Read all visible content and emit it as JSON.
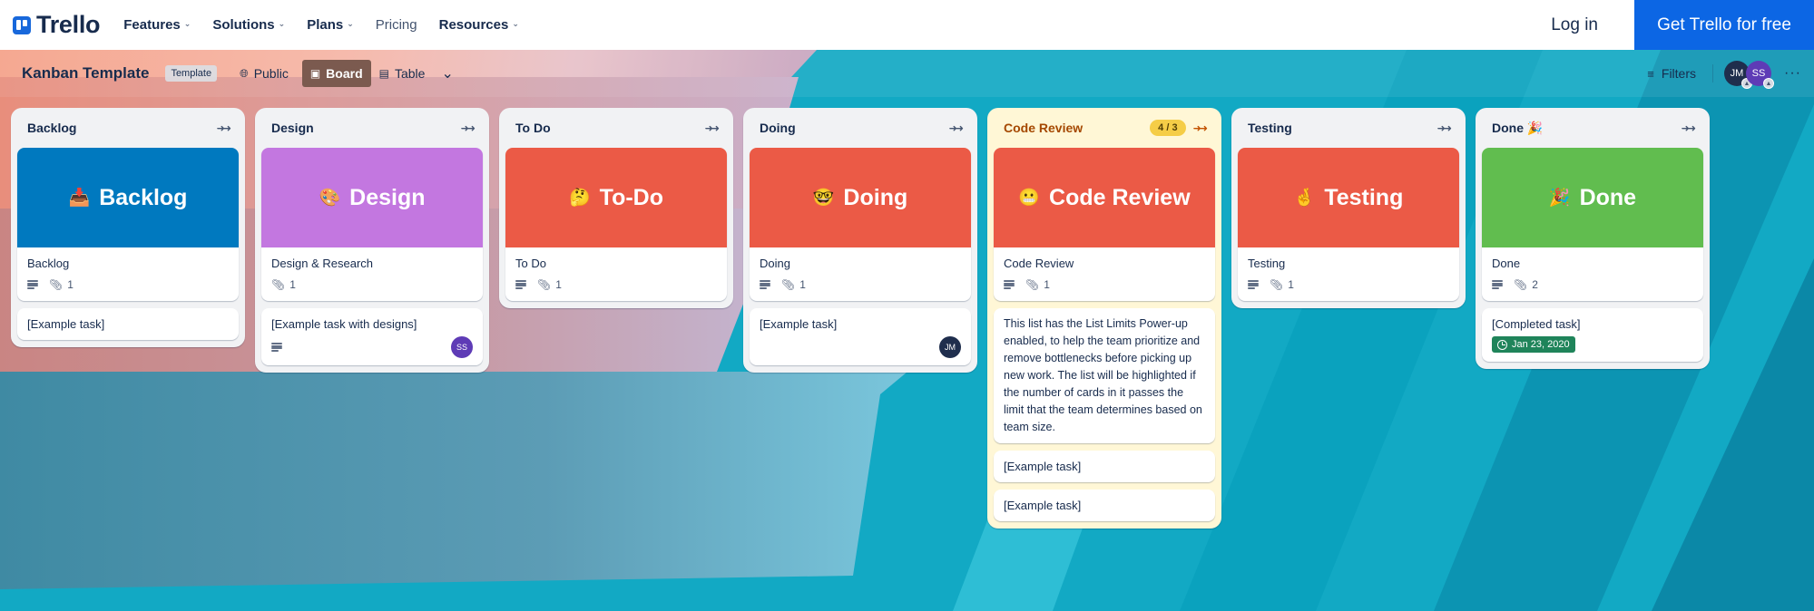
{
  "topnav": {
    "brand": "Trello",
    "items": [
      {
        "label": "Features",
        "has_menu": true
      },
      {
        "label": "Solutions",
        "has_menu": true
      },
      {
        "label": "Plans",
        "has_menu": true
      },
      {
        "label": "Pricing",
        "has_menu": false
      },
      {
        "label": "Resources",
        "has_menu": true
      }
    ],
    "login_label": "Log in",
    "cta_label": "Get Trello for free",
    "cta_color": "#0c66e4"
  },
  "board_header": {
    "title": "Kanban Template",
    "badge": "Template",
    "visibility": "Public",
    "views": [
      {
        "label": "Board",
        "icon": "board-icon",
        "active": true
      },
      {
        "label": "Table",
        "icon": "table-icon",
        "active": false
      }
    ],
    "more_views_icon": "chevron-down-icon",
    "filters_label": "Filters",
    "members": [
      {
        "initials": "JM",
        "color": "#1f2e4d"
      },
      {
        "initials": "SS",
        "color": "#5e3bb6"
      }
    ],
    "more_label": "···"
  },
  "lists": [
    {
      "title": "Backlog",
      "cards": [
        {
          "cover": {
            "emoji": "📥",
            "text": "Backlog",
            "color": "#0079bf"
          },
          "title": "Backlog",
          "has_description": true,
          "attachments": "1"
        },
        {
          "title": "[Example task]"
        }
      ]
    },
    {
      "title": "Design",
      "cards": [
        {
          "cover": {
            "emoji": "🎨",
            "text": "Design",
            "color": "#c377e0"
          },
          "title": "Design & Research",
          "has_description": false,
          "attachments": "1"
        },
        {
          "title": "[Example task with designs]",
          "has_description": true,
          "member": {
            "initials": "SS",
            "color": "#5e3bb6"
          }
        }
      ]
    },
    {
      "title": "To Do",
      "cards": [
        {
          "cover": {
            "emoji": "🤔",
            "text": "To-Do",
            "color": "#eb5a46"
          },
          "title": "To Do",
          "has_description": true,
          "attachments": "1"
        }
      ]
    },
    {
      "title": "Doing",
      "cards": [
        {
          "cover": {
            "emoji": "🤓",
            "text": "Doing",
            "color": "#eb5a46"
          },
          "title": "Doing",
          "has_description": true,
          "attachments": "1"
        },
        {
          "title": "[Example task]",
          "member": {
            "initials": "JM",
            "color": "#1f2e4d"
          }
        }
      ]
    },
    {
      "title": "Code Review",
      "limit_badge": "4 / 3",
      "over_limit": true,
      "cards": [
        {
          "cover": {
            "emoji": "😬",
            "text": "Code Review",
            "color": "#eb5a46"
          },
          "title": "Code Review",
          "has_description": true,
          "attachments": "1"
        },
        {
          "title": "This list has the List Limits Power-up enabled, to help the team prioritize and remove bottlenecks before picking up new work. The list will be highlighted if the number of cards in it passes the limit that the team determines based on team size."
        },
        {
          "title": "[Example task]"
        },
        {
          "title": "[Example task]"
        }
      ]
    },
    {
      "title": "Testing",
      "cards": [
        {
          "cover": {
            "emoji": "🤞",
            "text": "Testing",
            "color": "#eb5a46"
          },
          "title": "Testing",
          "has_description": true,
          "attachments": "1"
        }
      ]
    },
    {
      "title": "Done 🎉",
      "cards": [
        {
          "cover": {
            "emoji": "🎉",
            "text": "Done",
            "color": "#61bd4f"
          },
          "title": "Done",
          "has_description": true,
          "attachments": "2"
        },
        {
          "title": "[Completed task]",
          "due": {
            "label": "Jan 23, 2020",
            "color": "#1f845a"
          }
        }
      ]
    }
  ]
}
